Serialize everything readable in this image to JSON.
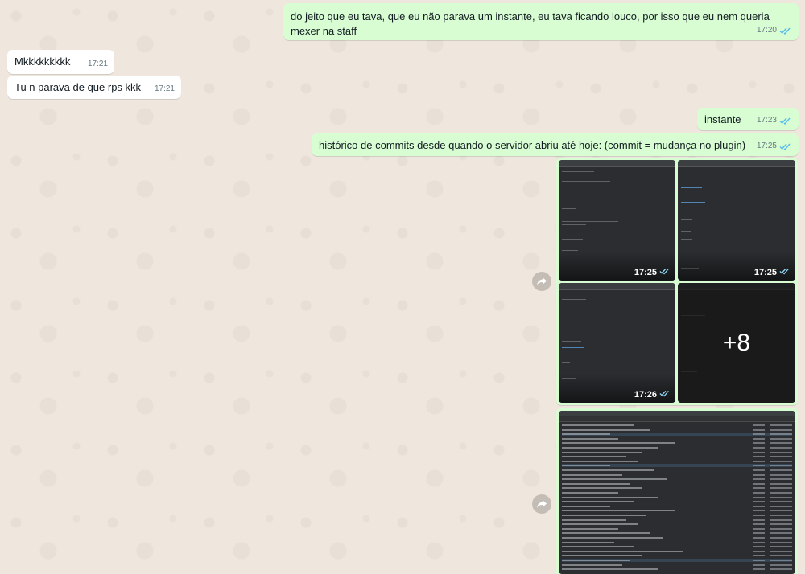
{
  "messages": [
    {
      "id": "m1",
      "dir": "out",
      "text": "do jeito que eu tava, que eu não parava um instante, eu tava ficando louco, por isso que eu nem queria mexer na staff",
      "time": "17:20"
    },
    {
      "id": "m2",
      "dir": "in",
      "text": "Mkkkkkkkkk",
      "time": "17:21"
    },
    {
      "id": "m3",
      "dir": "in",
      "text": "Tu n parava de que rps kkk",
      "time": "17:21"
    },
    {
      "id": "m4",
      "dir": "out",
      "text": "instante",
      "time": "17:23"
    },
    {
      "id": "m5",
      "dir": "out",
      "text": "histórico de commits desde quando o servidor abriu até hoje: (commit = mudança no plugin)",
      "time": "17:25"
    }
  ],
  "media_group": {
    "thumbs": [
      {
        "time": "17:25"
      },
      {
        "time": "17:25"
      },
      {
        "time": "17:26"
      },
      {
        "more_label": "+8"
      }
    ]
  },
  "colors": {
    "out_bubble": "#d9fdd3",
    "in_bubble": "#ffffff",
    "read_ticks": "#53bdeb",
    "chat_bg": "#efe7dd"
  },
  "icons": {
    "read": "double-check-icon",
    "forward": "forward-icon"
  }
}
